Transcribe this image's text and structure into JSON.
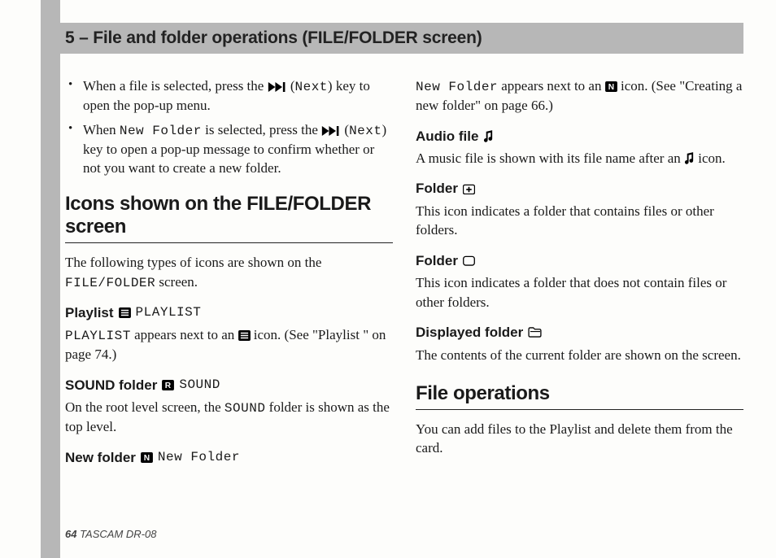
{
  "header": {
    "title": "5 – File and folder operations (FILE/FOLDER screen)"
  },
  "left": {
    "bullets": [
      {
        "pre": "When a file is selected, press the ",
        "next_mono": "Next",
        "post": ") key to open the pop-up menu."
      },
      {
        "pre": "When ",
        "newfolder_mono": "New Folder",
        "mid": " is selected, press the ",
        "next_mono": "Next",
        "post": ") key to open a pop-up message to confirm whether or not you want to create a new folder."
      }
    ],
    "h2_icons": "Icons shown on the FILE/FOLDER screen",
    "intro_a": "The following types of icons are shown on the ",
    "intro_mono": "FILE/FOLDER",
    "intro_b": " screen.",
    "playlist_label": "Playlist",
    "playlist_mono_head": "PLAYLIST",
    "playlist_mono_body": "PLAYLIST",
    "playlist_body_a": " appears next to an ",
    "playlist_body_b": " icon. (See \"Playlist \" on page 74.)",
    "sound_label": "SOUND folder",
    "sound_mono_head": "SOUND",
    "sound_body_a": "On the root level screen, the ",
    "sound_mono_body": "SOUND",
    "sound_body_b": " folder is shown as the top level.",
    "newfolder_label": "New folder",
    "newfolder_mono_head": "New Folder"
  },
  "right": {
    "nf_mono": "New Folder",
    "nf_a": " appears next to an ",
    "nf_b": " icon. (See \"Creating a new folder\" on page 66.)",
    "audio_label": "Audio file",
    "audio_body_a": "A music file is shown with its file name after an ",
    "audio_body_b": " icon.",
    "folder_plus_label": "Folder",
    "folder_plus_body": "This icon indicates a folder that contains files or other folders.",
    "folder_empty_label": "Folder",
    "folder_empty_body": "This icon indicates a folder that does not contain files or other folders.",
    "displayed_label": "Displayed folder",
    "displayed_body": "The contents of the current folder are shown on the screen.",
    "h2_ops": "File operations",
    "ops_body": "You can add files to the Playlist and delete them from the card."
  },
  "footer": {
    "page": "64",
    "product": " TASCAM  DR-08"
  }
}
